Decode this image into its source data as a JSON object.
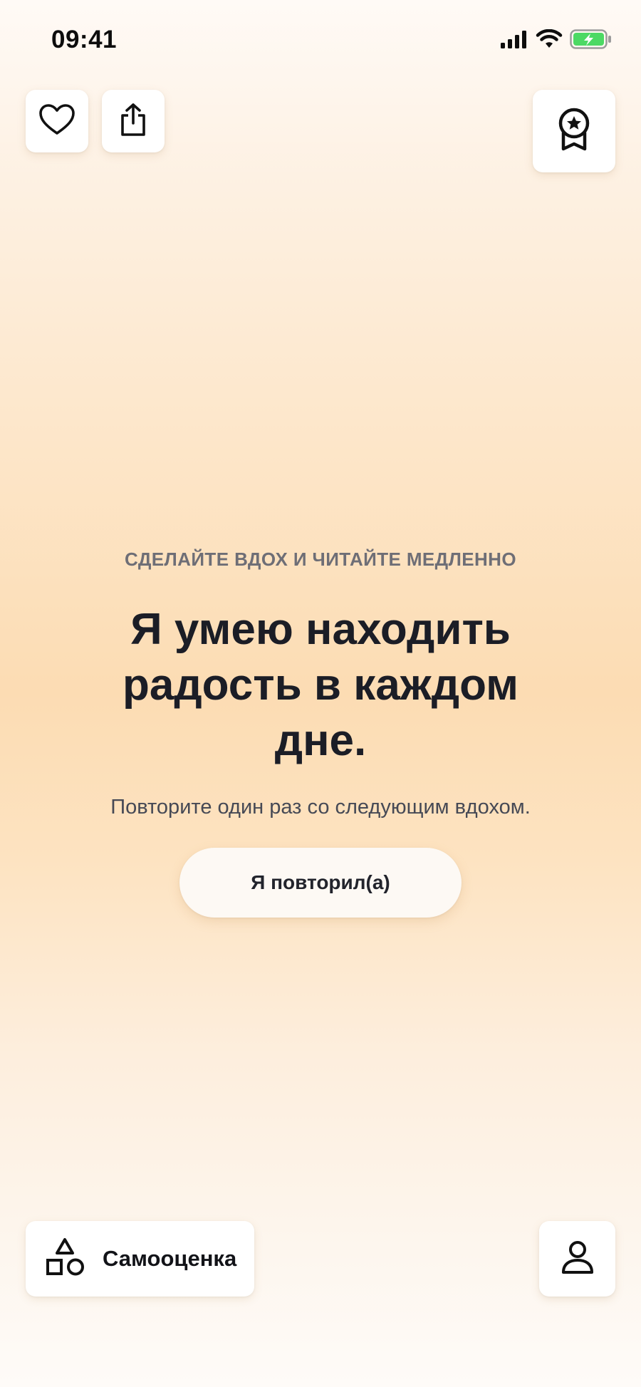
{
  "status_bar": {
    "time": "09:41",
    "icons": [
      "signal-icon",
      "wifi-icon",
      "battery-charging-icon"
    ],
    "battery_color": "#4cd964"
  },
  "top_actions": {
    "favorite_icon": "heart-icon",
    "share_icon": "share-icon",
    "achievements_icon": "award-ribbon-icon"
  },
  "content": {
    "eyebrow": "СДЕЛАЙТЕ ВДОХ И ЧИТАЙТЕ МЕДЛЕННО",
    "affirmation": "Я умею находить радость в каждом дне.",
    "hint": "Повторите один раз со следующим вдохом.",
    "repeat_button": "Я повторил(а)"
  },
  "bottom_nav": {
    "self_esteem_label": "Самооценка",
    "self_esteem_icon": "shapes-icon",
    "profile_icon": "person-icon"
  },
  "colors": {
    "background_top": "#fffaf6",
    "background_mid": "#fcdcb3",
    "text_primary": "#1b1d26",
    "text_secondary": "#6e6e76"
  }
}
